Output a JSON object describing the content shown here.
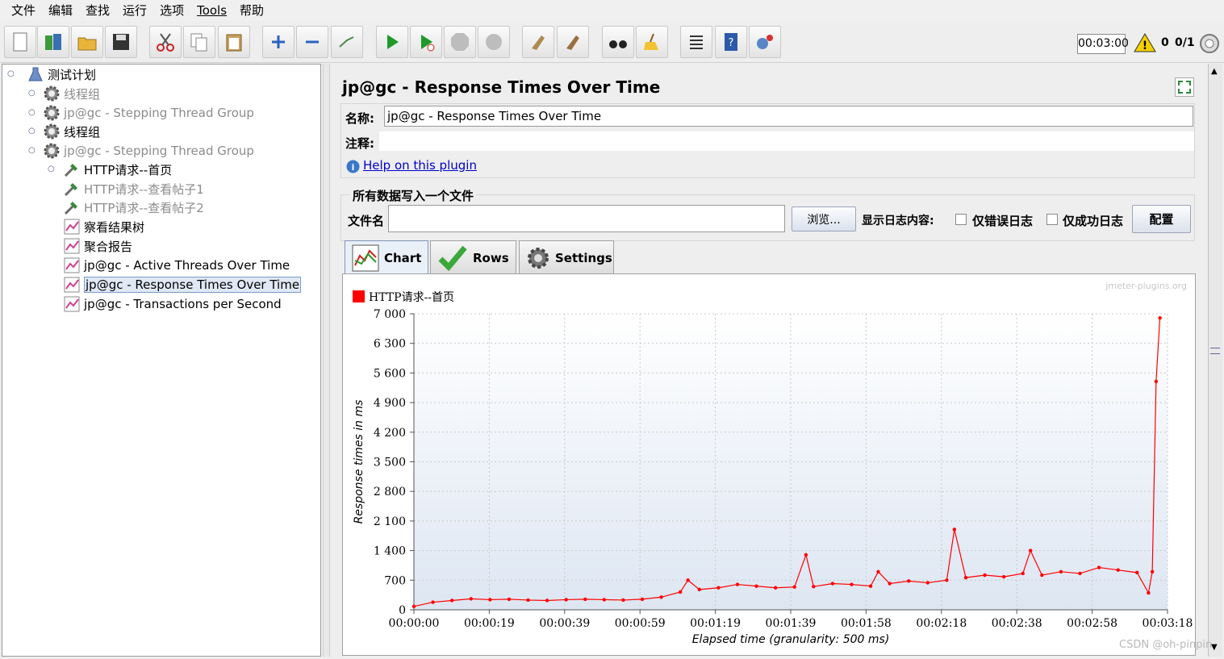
{
  "menu": [
    "文件",
    "编辑",
    "查找",
    "运行",
    "选项",
    "Tools",
    "帮助"
  ],
  "toolbar": {
    "timer": "00:03:00",
    "warnings": "0",
    "threads": "0/1"
  },
  "tree": {
    "items": [
      {
        "label": "测试计划",
        "icon": "test-plan-icon"
      },
      {
        "label": "线程组",
        "icon": "gear-icon",
        "dim": true
      },
      {
        "label": "jp@gc - Stepping Thread Group",
        "icon": "gear-icon",
        "dim": true
      },
      {
        "label": "线程组",
        "icon": "gear-icon"
      },
      {
        "label": "jp@gc - Stepping Thread Group",
        "icon": "gear-icon",
        "dim": true
      },
      {
        "label": "HTTP请求--首页",
        "icon": "pipette-icon"
      },
      {
        "label": "HTTP请求--查看帖子1",
        "icon": "pipette-icon",
        "dim": true
      },
      {
        "label": "HTTP请求--查看帖子2",
        "icon": "pipette-icon",
        "dim": true
      },
      {
        "label": "察看结果树",
        "icon": "graph-icon"
      },
      {
        "label": "聚合报告",
        "icon": "graph-icon"
      },
      {
        "label": "jp@gc - Active Threads Over Time",
        "icon": "graph-icon"
      },
      {
        "label": "jp@gc - Response Times Over Time",
        "icon": "graph-icon",
        "selected": true
      },
      {
        "label": "jp@gc - Transactions per Second",
        "icon": "graph-icon"
      }
    ]
  },
  "panel": {
    "title": "jp@gc - Response Times Over Time",
    "name_label": "名称:",
    "name_value": "jp@gc - Response Times Over Time",
    "comment_label": "注释:",
    "comment_value": "",
    "help_link": "Help on this plugin",
    "file_group": "所有数据写入一个文件",
    "file_label": "文件名",
    "file_value": "",
    "browse": "浏览...",
    "log_label": "显示日志内容:",
    "errors_only": "仅错误日志",
    "success_only": "仅成功日志",
    "configure": "配置"
  },
  "tabs": [
    "Chart",
    "Rows",
    "Settings"
  ],
  "chart_data": {
    "type": "line",
    "watermark": "jmeter-plugins.org",
    "xlabel": "Elapsed time (granularity: 500 ms)",
    "ylabel": "Response times in ms",
    "ylim": [
      0,
      7000
    ],
    "y_ticks": [
      "0",
      "700",
      "1 400",
      "2 100",
      "2 800",
      "3 500",
      "4 200",
      "4 900",
      "5 600",
      "6 300",
      "7 000"
    ],
    "x_ticks": [
      "00:00:00",
      "00:00:19",
      "00:00:39",
      "00:00:59",
      "00:01:19",
      "00:01:39",
      "00:01:58",
      "00:02:18",
      "00:02:38",
      "00:02:58",
      "00:03:18"
    ],
    "xlim_seconds": [
      0,
      198
    ],
    "series": [
      {
        "name": "HTTP请求--首页",
        "color": "#ff0000",
        "x": [
          0,
          5,
          10,
          15,
          20,
          25,
          30,
          35,
          40,
          45,
          50,
          55,
          60,
          65,
          70,
          72,
          75,
          80,
          85,
          90,
          95,
          100,
          103,
          105,
          110,
          115,
          120,
          122,
          125,
          130,
          135,
          140,
          142,
          145,
          150,
          155,
          160,
          162,
          165,
          170,
          175,
          180,
          185,
          190,
          193,
          194,
          195,
          196
        ],
        "values": [
          80,
          180,
          220,
          260,
          240,
          250,
          230,
          220,
          240,
          250,
          240,
          230,
          250,
          300,
          420,
          700,
          480,
          520,
          600,
          560,
          520,
          540,
          1300,
          550,
          620,
          600,
          560,
          900,
          620,
          680,
          640,
          700,
          1900,
          760,
          820,
          780,
          860,
          1400,
          820,
          900,
          860,
          1000,
          940,
          880,
          400,
          900,
          5400,
          6900
        ]
      }
    ]
  },
  "watermark_text": "CSDN @oh-pinpin"
}
